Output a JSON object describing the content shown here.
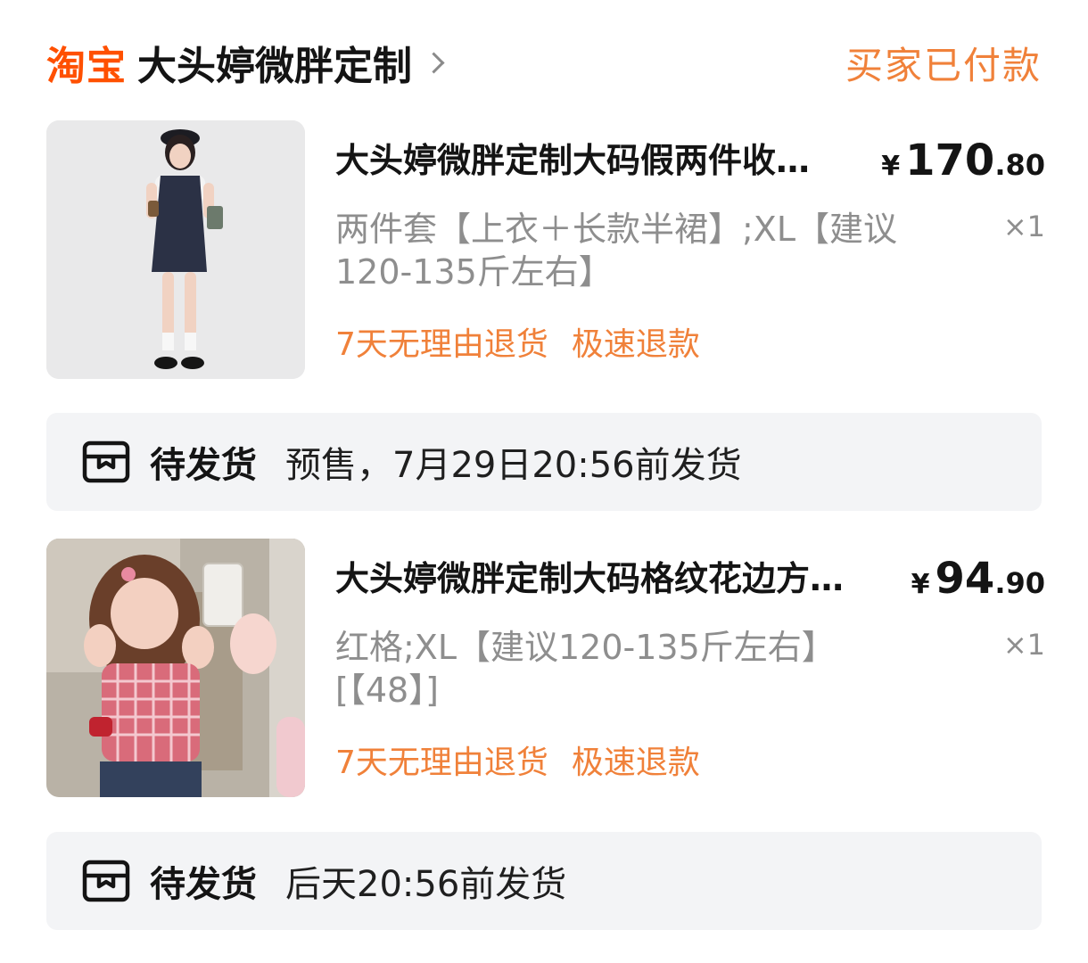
{
  "header": {
    "platform_logo": "淘宝",
    "shop_name": "大头婷微胖定制",
    "order_status": "买家已付款"
  },
  "products": [
    {
      "title": "大头婷微胖定制大码假两件收…",
      "price_currency": "¥",
      "price_integer": "170",
      "price_decimal": ".80",
      "spec": "两件套【上衣＋长款半裙】;XL【建议120-135斤左右】",
      "quantity": "×1",
      "tags": [
        "7天无理由退货",
        "极速退款"
      ],
      "image_icon": "product-photo-navy-two-piece-dress"
    },
    {
      "title": "大头婷微胖定制大码格纹花边方…",
      "price_currency": "¥",
      "price_integer": "94",
      "price_decimal": ".90",
      "spec": "红格;XL【建议120-135斤左右】[【48】]",
      "quantity": "×1",
      "tags": [
        "7天无理由退货",
        "极速退款"
      ],
      "image_icon": "product-photo-red-plaid-top"
    }
  ],
  "shipping": [
    {
      "icon": "package-box-icon",
      "status": "待发货",
      "note": "预售，7月29日20:56前发货"
    },
    {
      "icon": "package-box-icon",
      "status": "待发货",
      "note": "后天20:56前发货"
    }
  ],
  "colors": {
    "brand_orange": "#ff5000",
    "accent_orange": "#f0813a",
    "text_primary": "#141414",
    "text_secondary": "#8e8e8e",
    "panel_bg": "#f3f4f6"
  }
}
